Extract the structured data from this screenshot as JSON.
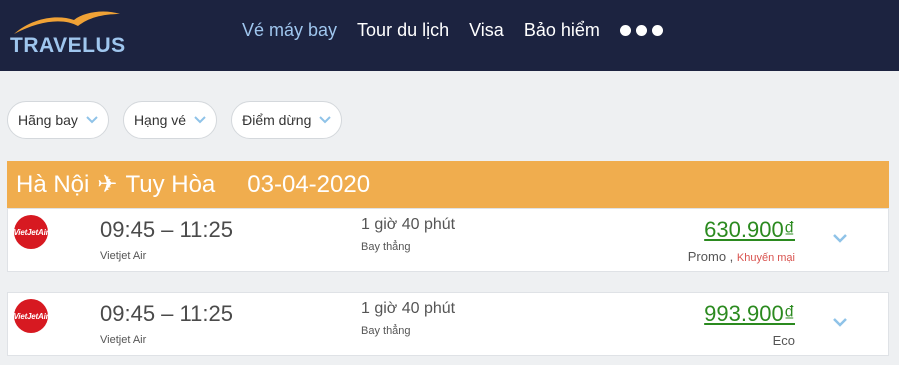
{
  "header": {
    "logo_text": "TRAVELUS",
    "nav": [
      {
        "label": "Vé máy bay",
        "active": true
      },
      {
        "label": "Tour du lịch",
        "active": false
      },
      {
        "label": "Visa",
        "active": false
      },
      {
        "label": "Bảo hiểm",
        "active": false
      }
    ],
    "more_icon": "ellipsis-dots-icon"
  },
  "filters": [
    {
      "label": "Hãng bay"
    },
    {
      "label": "Hạng vé"
    },
    {
      "label": "Điểm dừng"
    }
  ],
  "route": {
    "origin": "Hà Nội",
    "plane_glyph": "✈",
    "destination": "Tuy Hòa",
    "date": "03-04-2020"
  },
  "flights": [
    {
      "logo_text": "VietJetAir",
      "time": "09:45 – 11:25",
      "airline": "Vietjet Air",
      "duration": "1 giờ 40 phút",
      "stops": "Bay thẳng",
      "price": "630.900₫",
      "fare_class": "Promo",
      "separator": " , ",
      "promo_note": "Khuyến mại"
    },
    {
      "logo_text": "VietJetAir",
      "time": "09:45 – 11:25",
      "airline": "Vietjet Air",
      "duration": "1 giờ 40 phút",
      "stops": "Bay thẳng",
      "price": "993.900₫",
      "fare_class": "Eco"
    }
  ],
  "colors": {
    "header_bg": "#1c2340",
    "nav_active": "#9fc6ee",
    "route_bar": "#f0ad4e",
    "price": "#2b8a1f",
    "promo": "#d9534f",
    "airline_red": "#d71921",
    "chevron": "#8fc3e8"
  }
}
